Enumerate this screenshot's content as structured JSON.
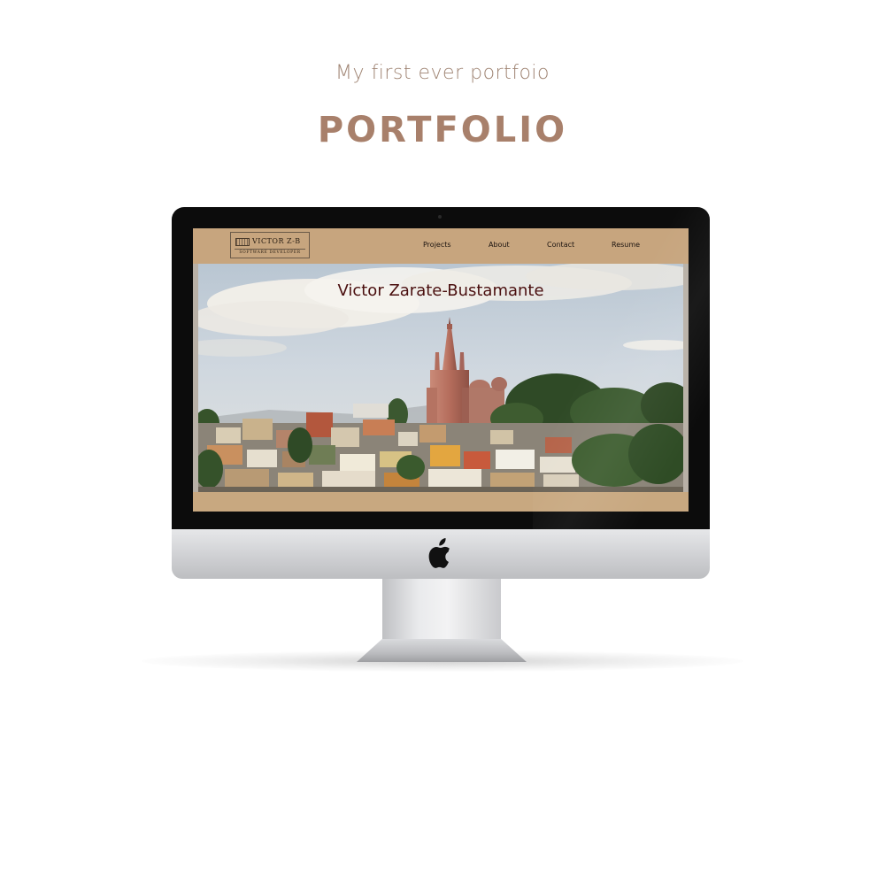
{
  "header": {
    "subtitle": "My first ever portfoio",
    "title": "PORTFOLIO"
  },
  "website": {
    "logo": {
      "name": "VICTOR Z-B",
      "tagline": "SOFTWARE DEVELOPER"
    },
    "nav": {
      "items": [
        {
          "label": "Projects"
        },
        {
          "label": "About"
        },
        {
          "label": "Contact"
        },
        {
          "label": "Resume"
        }
      ]
    },
    "hero": {
      "title": "Victor Zarate-Bustamante"
    }
  },
  "colors": {
    "heading_brown": "#a8806b",
    "nav_tan": "#c7a57e",
    "hero_title": "#4a0f0f"
  },
  "icons": {
    "device_logo": "apple-icon"
  }
}
